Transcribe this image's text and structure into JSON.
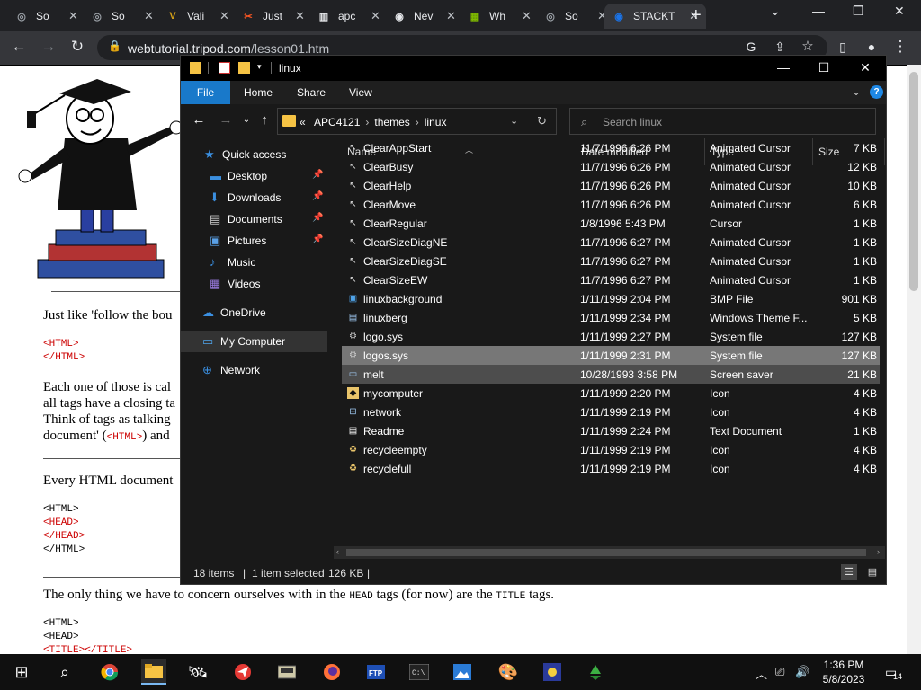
{
  "browser": {
    "tabs": [
      {
        "label": "So",
        "icon": "globe-icon"
      },
      {
        "label": "So",
        "icon": "globe-icon"
      },
      {
        "label": "Vali",
        "icon": "vali-icon"
      },
      {
        "label": "Just",
        "icon": "just-icon"
      },
      {
        "label": "apc",
        "icon": "building-icon"
      },
      {
        "label": "Nev",
        "icon": "github-icon"
      },
      {
        "label": "Wh",
        "icon": "microsoft-icon"
      },
      {
        "label": "So",
        "icon": "globe-icon"
      },
      {
        "label": "STACKT",
        "icon": "stack-icon"
      }
    ],
    "url_host": "webtutorial.tripod.com",
    "url_path": "/lesson01.htm"
  },
  "page": {
    "p1": "Just like 'follow the bou",
    "code1": [
      "<HTML>",
      "</HTML>"
    ],
    "p2_lines": [
      "Each one of those is cal",
      "all tags have a closing ta",
      "Think of tags as talking",
      "document' ("
    ],
    "p2_code": "<HTML>",
    "p2_tail": ") and",
    "p3": "Every HTML document",
    "code2": [
      "<HTML>",
      "<HEAD>",
      "</HEAD>",
      "</HTML>"
    ],
    "p4_a": "The only thing we have to concern ourselves with in the ",
    "p4_head": "HEAD",
    "p4_b": " tags (for now) are the ",
    "p4_title": "TITLE",
    "p4_c": " tags.",
    "code3": [
      "<HTML>",
      "<HEAD>",
      "<TITLE></TITLE>"
    ]
  },
  "explorer": {
    "title": "linux",
    "ribbon": {
      "file": "File",
      "home": "Home",
      "share": "Share",
      "view": "View",
      "help": "?"
    },
    "breadcrumb": {
      "prefix": "«",
      "items": [
        "APC4121",
        "themes",
        "linux"
      ]
    },
    "search_placeholder": "Search linux",
    "nav": [
      {
        "label": "Quick access",
        "icon": "star-icon",
        "color": "#3b8fe0",
        "pinned": false
      },
      {
        "label": "Desktop",
        "icon": "desktop-icon",
        "color": "#3b8fe0",
        "pinned": true
      },
      {
        "label": "Downloads",
        "icon": "download-icon",
        "color": "#3b8fe0",
        "pinned": true
      },
      {
        "label": "Documents",
        "icon": "documents-icon",
        "color": "#d6d6d6",
        "pinned": true
      },
      {
        "label": "Pictures",
        "icon": "pictures-icon",
        "color": "#5aa0e6",
        "pinned": true
      },
      {
        "label": "Music",
        "icon": "music-icon",
        "color": "#3b8fe0",
        "pinned": false
      },
      {
        "label": "Videos",
        "icon": "videos-icon",
        "color": "#9a7be0",
        "pinned": false
      },
      {
        "label": "OneDrive",
        "icon": "cloud-icon",
        "color": "#3b8fe0",
        "pinned": false
      },
      {
        "label": "My Computer",
        "icon": "computer-icon",
        "color": "#4fa3e8",
        "pinned": false
      },
      {
        "label": "Network",
        "icon": "network-icon",
        "color": "#3b8fe0",
        "pinned": false
      }
    ],
    "columns": {
      "name": "Name",
      "date": "Date modified",
      "type": "Type",
      "size": "Size"
    },
    "files": [
      {
        "name": "ClearAppStart",
        "date": "11/7/1996 6:26 PM",
        "type": "Animated Cursor",
        "size": "7 KB",
        "icon": "cursor-icon"
      },
      {
        "name": "ClearBusy",
        "date": "11/7/1996 6:26 PM",
        "type": "Animated Cursor",
        "size": "12 KB",
        "icon": "cursor-icon"
      },
      {
        "name": "ClearHelp",
        "date": "11/7/1996 6:26 PM",
        "type": "Animated Cursor",
        "size": "10 KB",
        "icon": "cursor-icon"
      },
      {
        "name": "ClearMove",
        "date": "11/7/1996 6:26 PM",
        "type": "Animated Cursor",
        "size": "6 KB",
        "icon": "cursor-icon"
      },
      {
        "name": "ClearRegular",
        "date": "1/8/1996 5:43 PM",
        "type": "Cursor",
        "size": "1 KB",
        "icon": "cursor-icon"
      },
      {
        "name": "ClearSizeDiagNE",
        "date": "11/7/1996 6:27 PM",
        "type": "Animated Cursor",
        "size": "1 KB",
        "icon": "cursor-icon"
      },
      {
        "name": "ClearSizeDiagSE",
        "date": "11/7/1996 6:27 PM",
        "type": "Animated Cursor",
        "size": "1 KB",
        "icon": "cursor-icon"
      },
      {
        "name": "ClearSizeEW",
        "date": "11/7/1996 6:27 PM",
        "type": "Animated Cursor",
        "size": "1 KB",
        "icon": "cursor-icon"
      },
      {
        "name": "linuxbackground",
        "date": "1/11/1999 2:04 PM",
        "type": "BMP File",
        "size": "901 KB",
        "icon": "image-icon"
      },
      {
        "name": "linuxberg",
        "date": "1/11/1999 2:34 PM",
        "type": "Windows Theme F...",
        "size": "5 KB",
        "icon": "theme-icon"
      },
      {
        "name": "logo.sys",
        "date": "1/11/1999 2:27 PM",
        "type": "System file",
        "size": "127 KB",
        "icon": "system-file-icon"
      },
      {
        "name": "logos.sys",
        "date": "1/11/1999 2:31 PM",
        "type": "System file",
        "size": "127 KB",
        "icon": "system-file-icon",
        "selected": true
      },
      {
        "name": "melt",
        "date": "10/28/1993 3:58 PM",
        "type": "Screen saver",
        "size": "21 KB",
        "icon": "screensaver-icon",
        "hover": true
      },
      {
        "name": "mycomputer",
        "date": "1/11/1999 2:20 PM",
        "type": "Icon",
        "size": "4 KB",
        "icon": "penguin-icon"
      },
      {
        "name": "network",
        "date": "1/11/1999 2:19 PM",
        "type": "Icon",
        "size": "4 KB",
        "icon": "network-file-icon"
      },
      {
        "name": "Readme",
        "date": "1/11/1999 2:24 PM",
        "type": "Text Document",
        "size": "1 KB",
        "icon": "text-file-icon"
      },
      {
        "name": "recycleempty",
        "date": "1/11/1999 2:19 PM",
        "type": "Icon",
        "size": "4 KB",
        "icon": "recycle-icon"
      },
      {
        "name": "recyclefull",
        "date": "1/11/1999 2:19 PM",
        "type": "Icon",
        "size": "4 KB",
        "icon": "recycle-icon"
      }
    ],
    "status": {
      "count": "18 items",
      "selected": "1 item selected",
      "size": "126 KB"
    }
  },
  "taskbar": {
    "time": "1:36 PM",
    "date": "5/8/2023",
    "notifications": "14"
  }
}
